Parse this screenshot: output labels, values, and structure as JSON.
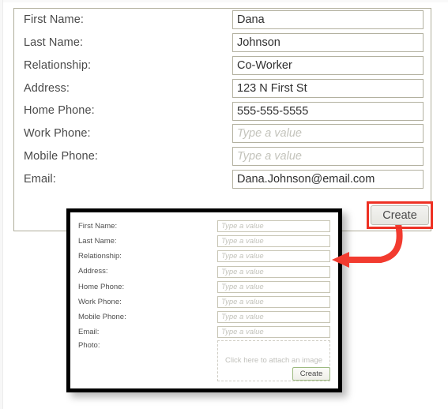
{
  "main_form": {
    "placeholder": "Type a value",
    "fields": [
      {
        "label": "First Name:",
        "value": "Dana",
        "is_placeholder": false
      },
      {
        "label": "Last Name:",
        "value": "Johnson",
        "is_placeholder": false
      },
      {
        "label": "Relationship:",
        "value": "Co-Worker",
        "is_placeholder": false
      },
      {
        "label": "Address:",
        "value": "123 N First St",
        "is_placeholder": false
      },
      {
        "label": "Home Phone:",
        "value": "555-555-5555",
        "is_placeholder": false
      },
      {
        "label": "Work Phone:",
        "value": "Type a value",
        "is_placeholder": true
      },
      {
        "label": "Mobile Phone:",
        "value": "Type a value",
        "is_placeholder": true
      },
      {
        "label": "Email:",
        "value": "Dana.Johnson@email.com",
        "is_placeholder": false
      }
    ],
    "create_label": "Create"
  },
  "inset_dialog": {
    "placeholder": "Type a value",
    "fields": [
      {
        "label": "First Name:",
        "value": "Type a value"
      },
      {
        "label": "Last Name:",
        "value": "Type a value"
      },
      {
        "label": "Relationship:",
        "value": "Type a value"
      },
      {
        "label": "Address:",
        "value": "Type a value"
      },
      {
        "label": "Home Phone:",
        "value": "Type a value"
      },
      {
        "label": "Work Phone:",
        "value": "Type a value"
      },
      {
        "label": "Mobile Phone:",
        "value": "Type a value"
      },
      {
        "label": "Email:",
        "value": "Type a value"
      }
    ],
    "photo_label": "Photo:",
    "photo_dropzone_text": "Click here to attach an image",
    "create_label": "Create"
  },
  "annotations": {
    "highlight_color": "#ee3124",
    "arrow_color": "#f23b2f"
  }
}
